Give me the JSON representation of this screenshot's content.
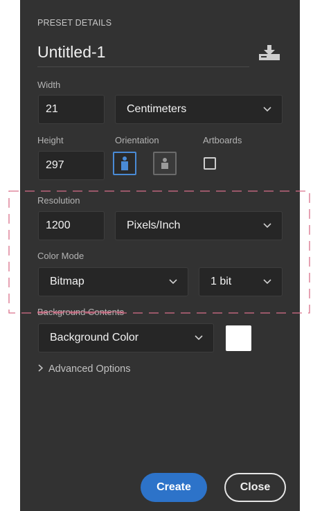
{
  "preset_details": {
    "title": "PRESET DETAILS",
    "document_name": "Untitled-1"
  },
  "width": {
    "label": "Width",
    "value": "21",
    "unit": "Centimeters"
  },
  "height": {
    "label": "Height",
    "value": "297"
  },
  "orientation": {
    "label": "Orientation",
    "selected": "portrait"
  },
  "artboards": {
    "label": "Artboards",
    "checked": false
  },
  "resolution": {
    "label": "Resolution",
    "value": "1200",
    "unit": "Pixels/Inch"
  },
  "color_mode": {
    "label": "Color Mode",
    "mode": "Bitmap",
    "depth": "1 bit"
  },
  "background_contents": {
    "label": "Background Contents",
    "value": "Background Color",
    "swatch_color": "#ffffff"
  },
  "advanced_options": {
    "label": "Advanced Options"
  },
  "buttons": {
    "create": "Create",
    "close": "Close"
  },
  "colors": {
    "panel": "#323232",
    "accent": "#2d73c9",
    "highlight_dash": "#d9708a"
  }
}
